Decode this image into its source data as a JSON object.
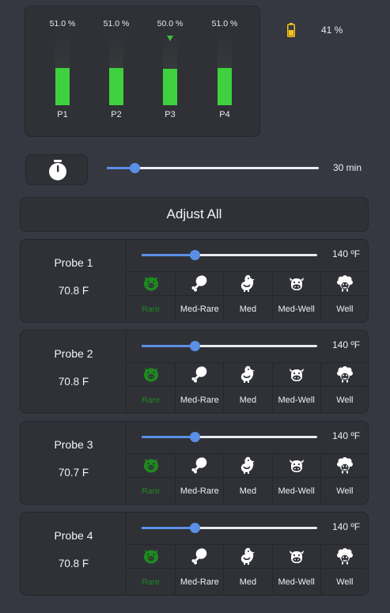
{
  "bars": [
    {
      "name": "P1",
      "percent_label": "51.0 %",
      "level": 0.51,
      "marker": false
    },
    {
      "name": "P2",
      "percent_label": "51.0 %",
      "level": 0.51,
      "marker": false
    },
    {
      "name": "P3",
      "percent_label": "50.0 %",
      "level": 0.5,
      "marker": true
    },
    {
      "name": "P4",
      "percent_label": "51.0 %",
      "level": 0.51,
      "marker": false
    }
  ],
  "battery": {
    "icon": "battery-icon",
    "value": "41 %",
    "color": "#f5c518"
  },
  "timer": {
    "icon": "stopwatch-icon",
    "value": "30 min",
    "level": 0.13
  },
  "adjust_all": {
    "label": "Adjust All"
  },
  "colors": {
    "accent": "#5b8fe6",
    "bar_green": "#3fd13f",
    "selected_green": "#1f8a1f"
  },
  "doneness_levels": [
    {
      "label": "Rare",
      "icon": "pig-icon"
    },
    {
      "label": "Med-Rare",
      "icon": "drumstick-icon"
    },
    {
      "label": "Med",
      "icon": "chicken-icon"
    },
    {
      "label": "Med-Well",
      "icon": "cow-icon"
    },
    {
      "label": "Well",
      "icon": "sheep-icon"
    }
  ],
  "probes": [
    {
      "name": "Probe 1",
      "temp": "70.8 F",
      "target": "140 ºF",
      "level": 0.3,
      "selected": 0
    },
    {
      "name": "Probe 2",
      "temp": "70.8 F",
      "target": "140 ºF",
      "level": 0.3,
      "selected": 0
    },
    {
      "name": "Probe 3",
      "temp": "70.7 F",
      "target": "140 ºF",
      "level": 0.3,
      "selected": 0
    },
    {
      "name": "Probe 4",
      "temp": "70.8 F",
      "target": "140 ºF",
      "level": 0.3,
      "selected": 0
    }
  ]
}
